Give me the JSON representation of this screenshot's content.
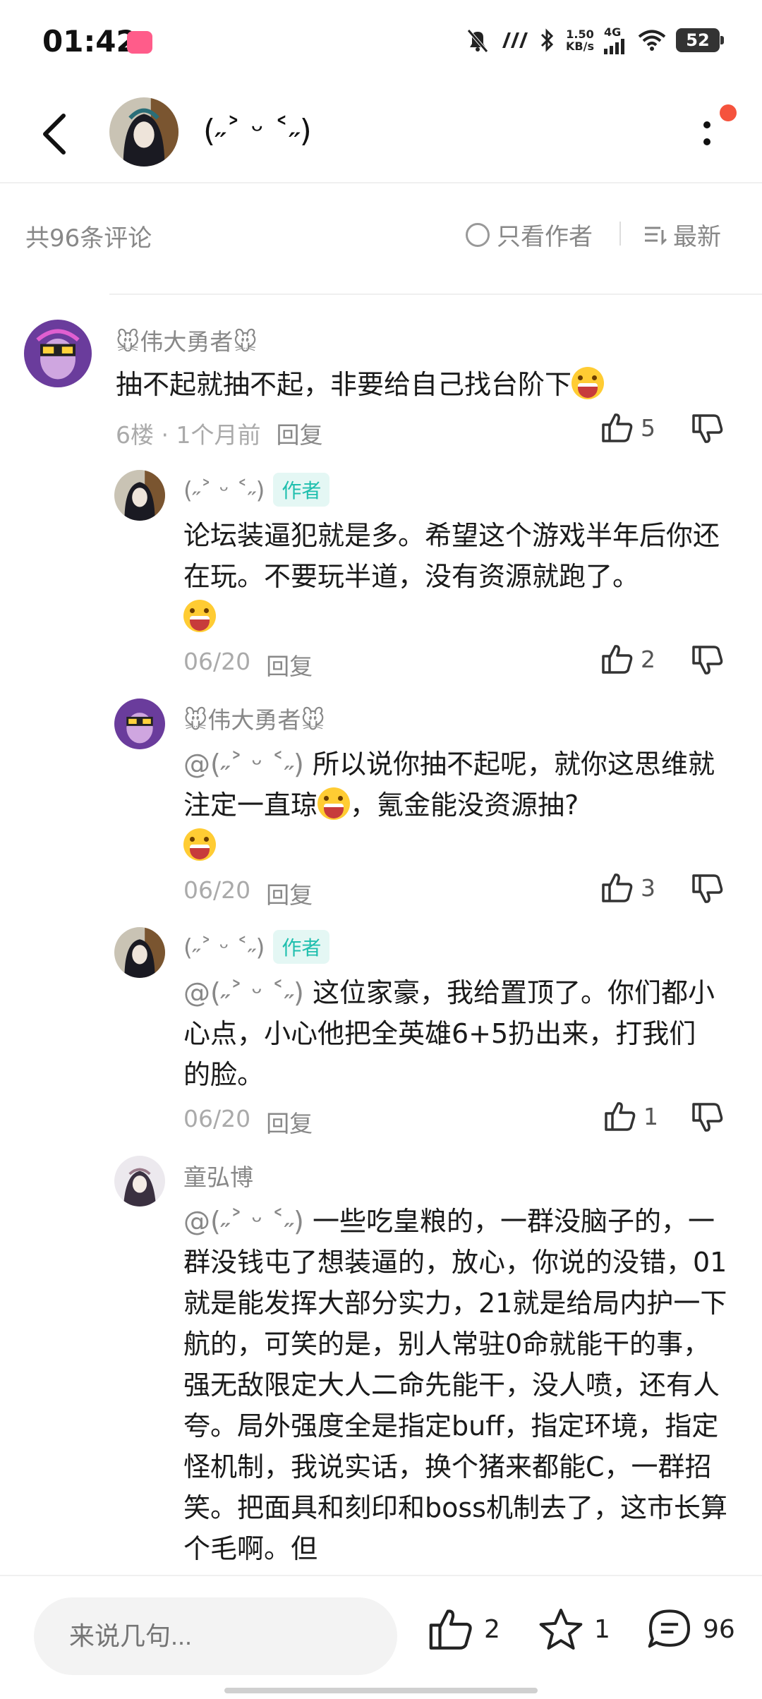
{
  "status_bar": {
    "time": "01:42",
    "speed_value": "1.50",
    "speed_unit": "KB/s",
    "network": "4G",
    "battery": "52"
  },
  "header": {
    "title": "(˶˃ ᵕ ˂˶)"
  },
  "filter": {
    "count_label": "共96条评论",
    "author_only_label": "只看作者",
    "sort_label": "最新"
  },
  "comments": [
    {
      "name": "🐭伟大勇者🐭",
      "is_author": false,
      "text": "抽不起就抽不起，非要给自己找台阶下",
      "floor": "6楼",
      "time": "1个月前",
      "reply_label": "回复",
      "likes": "5"
    },
    {
      "name": "(˶˃ ᵕ ˂˶)",
      "is_author": true,
      "author_tag": "作者",
      "text": "论坛装逼犯就是多。希望这个游戏半年后你还在玩。不要玩半道，没有资源就跑了。",
      "date": "06/20",
      "reply_label": "回复",
      "likes": "2"
    },
    {
      "name": "🐭伟大勇者🐭",
      "is_author": false,
      "mention": "@(˶˃ ᵕ ˂˶)",
      "text_a": "所以说你抽不起呢，就你这思维就注定一直琼",
      "text_b": "，氪金能没资源抽?",
      "date": "06/20",
      "reply_label": "回复",
      "likes": "3"
    },
    {
      "name": "(˶˃ ᵕ ˂˶)",
      "is_author": true,
      "author_tag": "作者",
      "mention": "@(˶˃ ᵕ ˂˶)",
      "text": "这位家豪，我给置顶了。你们都小心点，小心他把全英雄6+5扔出来，打我们的脸。",
      "date": "06/20",
      "reply_label": "回复",
      "likes": "1"
    },
    {
      "name": "童弘博",
      "is_author": false,
      "mention": "@(˶˃ ᵕ ˂˶)",
      "text": "一些吃皇粮的，一群没脑子的，一群没钱屯了想装逼的，放心，你说的没错，01就是能发挥大部分实力，21就是给局内护一下航的，可笑的是，别人常驻0命就能干的事，强无敌限定大人二命先能干，没人喷，还有人夸。局外强度全是指定buff，指定环境，指定怪机制，我说实话，换个猪来都能C，一群招笑。把面具和刻印和boss机制去了，这市长算个毛啊。但"
    }
  ],
  "bottom_bar": {
    "input_placeholder": "来说几句...",
    "like_count": "2",
    "fav_count": "1",
    "comment_count": "96"
  },
  "colors": {
    "author_tag": "#1fbfae",
    "notification_dot": "#f5533d",
    "app_badge": "#ff5c8a"
  }
}
